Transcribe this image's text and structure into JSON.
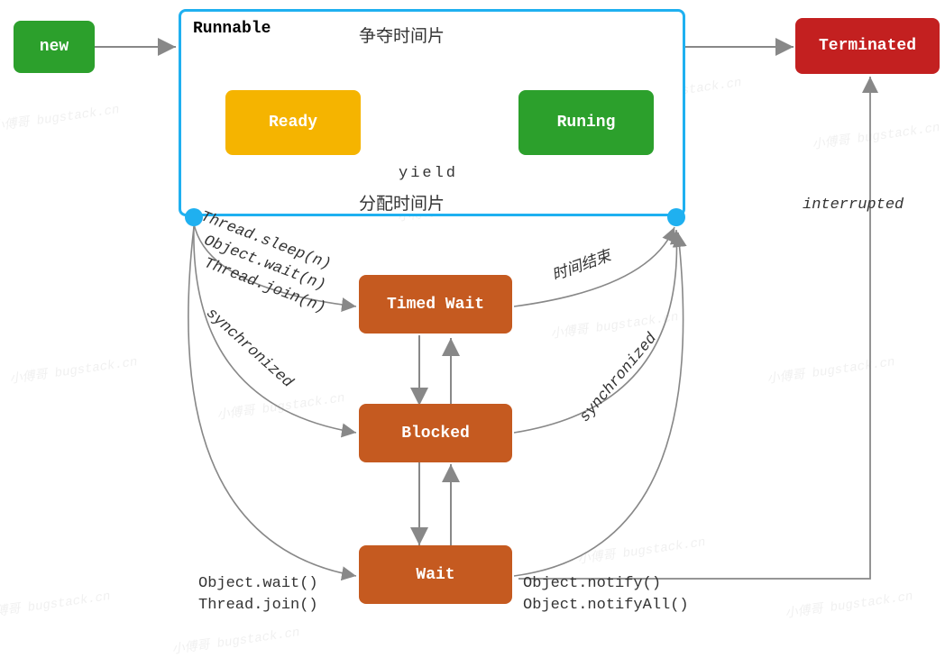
{
  "states": {
    "new": "new",
    "terminated": "Terminated",
    "runnable": "Runnable",
    "ready": "Ready",
    "running": "Runing",
    "timed_wait": "Timed Wait",
    "blocked": "Blocked",
    "wait": "Wait"
  },
  "transitions": {
    "compete_slice": "争夺时间片",
    "yield": "yield",
    "alloc_slice": "分配时间片",
    "interrupted": "interrupted",
    "thread_sleep_n": "Thread.sleep(n)",
    "object_wait_n": "Object.wait(n)",
    "thread_join_n": "Thread.join(n)",
    "synchronized_left": "synchronized",
    "synchronized_right": "synchronized",
    "time_over": "时间结束",
    "object_wait": "Object.wait()",
    "thread_join": "Thread.join()",
    "object_notify": "Object.notify()",
    "object_notifyAll": "Object.notifyAll()"
  },
  "watermark": "小傅哥 bugstack.cn"
}
